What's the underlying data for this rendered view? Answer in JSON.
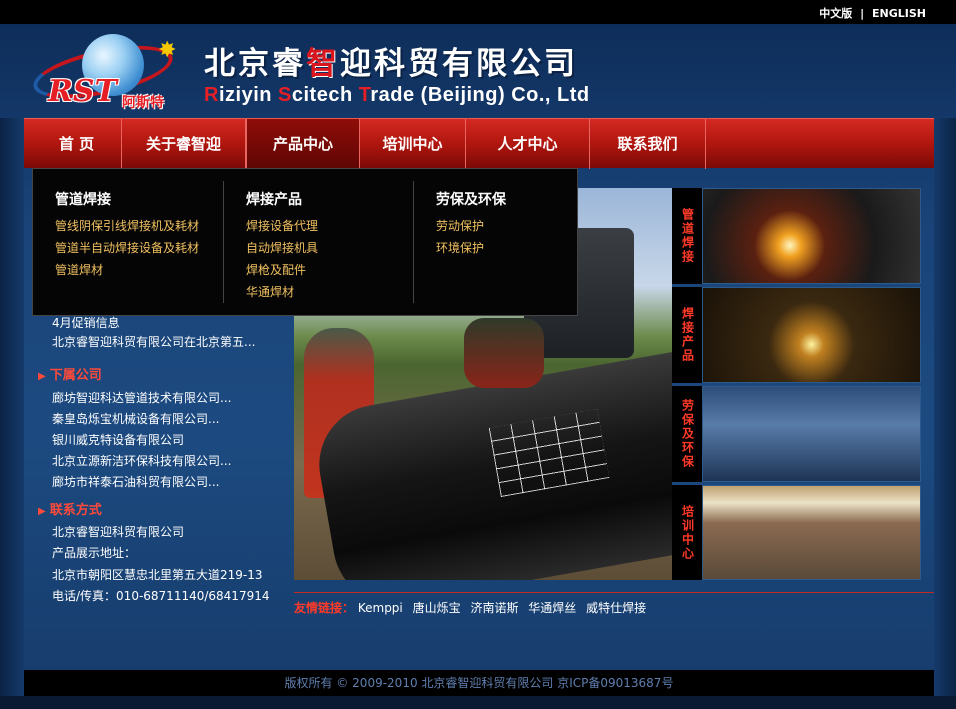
{
  "lang": {
    "cn": "中文版",
    "sep": "|",
    "en": "ENGLISH"
  },
  "header": {
    "logo_text": "RST",
    "logo_cn": "阿斯特",
    "company_cn_a": "北京睿",
    "company_cn_b": "智",
    "company_cn_c": "迎科贸有限公司",
    "company_en_r": "R",
    "company_en_1": "iziyin ",
    "company_en_s": "S",
    "company_en_2": "citech ",
    "company_en_t": "T",
    "company_en_3": "rade (Beijing) Co., Ltd"
  },
  "nav": {
    "items": [
      {
        "label": "首  页"
      },
      {
        "label": "关于睿智迎"
      },
      {
        "label": "产品中心"
      },
      {
        "label": "培训中心"
      },
      {
        "label": "人才中心"
      },
      {
        "label": "联系我们"
      }
    ]
  },
  "dropdown": {
    "cols": [
      {
        "head": "管道焊接",
        "items": [
          "管线阴保引线焊接机及耗材",
          "管道半自动焊接设备及耗材",
          "管道焊材"
        ]
      },
      {
        "head": "焊接产品",
        "items": [
          "焊接设备代理",
          "自动焊接机具",
          "焊枪及配件",
          "华通焊材"
        ]
      },
      {
        "head": "劳保及环保",
        "items": [
          "劳动保护",
          "环境保护"
        ]
      }
    ]
  },
  "sidebar": {
    "news_partial_1": "4月促销信息",
    "news_1": "北京睿智迎科贸有限公司在北京第五...",
    "news_partial_2": "...",
    "subsidiaries_title": "下属公司",
    "subsidiaries": [
      "廊坊智迎科达管道技术有限公司...",
      "秦皇岛烁宝机械设备有限公司...",
      "银川威克特设备有限公司",
      "北京立源新洁环保科技有限公司...",
      "廊坊市祥泰石油科贸有限公司..."
    ],
    "contact_title": "联系方式",
    "contact": [
      "北京睿智迎科贸有限公司",
      "产品展示地址：",
      "北京市朝阳区慧忠北里第五大道219-13",
      "电话/传真：010-68711140/68417914"
    ]
  },
  "thumbs": {
    "labels": [
      "管道焊接",
      "焊接产品",
      "劳保及环保",
      "培训中心"
    ]
  },
  "friend": {
    "label": "友情链接：",
    "links": [
      "Kemppi",
      "唐山烁宝",
      "济南诺斯",
      "华通焊丝",
      "威特仕焊接"
    ]
  },
  "footer": {
    "text": "版权所有 © 2009-2010 北京睿智迎科贸有限公司 京ICP备09013687号"
  }
}
